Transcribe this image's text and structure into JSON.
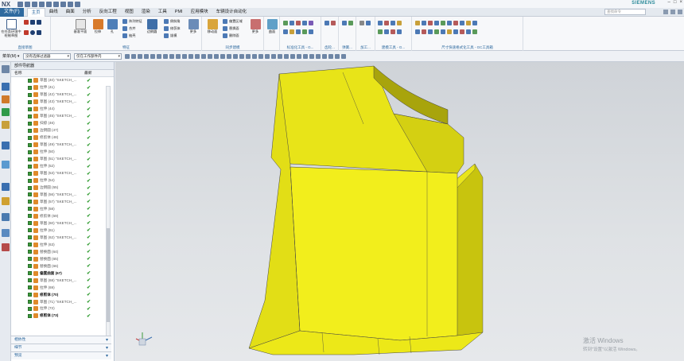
{
  "titlebar": {
    "app_logo": "NX",
    "window_title": "",
    "brand": "SIEMENS"
  },
  "tabs": {
    "file": "文件(F)",
    "items": [
      "主页",
      "曲线",
      "曲面",
      "分析",
      "视图",
      "渲染",
      "工具",
      "PMI",
      "应用模块",
      "车辆设计自动化"
    ],
    "extra": "反向工程",
    "active_index": 0,
    "search_placeholder": "查找命令"
  },
  "ribbon": {
    "sketch_button": "在任务环境中绘制草图",
    "group_direct_sketch": "直接草图",
    "group_feature": "特征",
    "group_sync": "同步建模",
    "group_standard": "标准化工具 - G...",
    "group_gear": "齿轮...",
    "group_spring": "弹簧...",
    "group_machining": "加工...",
    "group_build": "建模工具 - G...",
    "group_dimension": "尺寸快速格式化工具 - GC工具箱",
    "datum_plane": "基准平面",
    "extrude": "拉伸",
    "hole": "孔",
    "array_feature": "阵列特征",
    "unite": "合并",
    "shell": "抽壳",
    "edge_blend": "边倒圆",
    "chamfer": "倒斜角",
    "trim_body": "修剪体",
    "draft": "拔模",
    "more": "更多",
    "move_face": "移动面",
    "offset_region": "偏置区域",
    "replace_face": "替换面",
    "delete_face": "删除面",
    "surface": "曲面"
  },
  "selection_bar": {
    "menu": "菜单(M) ▾",
    "filter": "没有选择过滤器",
    "scope": "仅在工作部件内"
  },
  "navigator": {
    "title": "部件导航器",
    "col_name": "名称",
    "col_latest": "最新",
    "rows": [
      {
        "label": "草图 (40) \"SKETCH_..."
      },
      {
        "label": "拉伸 (41)"
      },
      {
        "label": "草图 (42) \"SKETCH_..."
      },
      {
        "label": "草图 (43) \"SKETCH_..."
      },
      {
        "label": "拉伸 (44)"
      },
      {
        "label": "草图 (45) \"SKETCH_..."
      },
      {
        "label": "扫掠 (46)"
      },
      {
        "label": "边倒圆 (47)"
      },
      {
        "label": "修剪体 (48)"
      },
      {
        "label": "草图 (49) \"SKETCH_..."
      },
      {
        "label": "拉伸 (50)"
      },
      {
        "label": "草图 (51) \"SKETCH_..."
      },
      {
        "label": "拉伸 (52)"
      },
      {
        "label": "草图 (53) \"SKETCH_..."
      },
      {
        "label": "拉伸 (54)"
      },
      {
        "label": "边倒圆 (55)"
      },
      {
        "label": "草图 (56) \"SKETCH_..."
      },
      {
        "label": "草图 (57) \"SKETCH_..."
      },
      {
        "label": "拉伸 (58)"
      },
      {
        "label": "修剪体 (59)"
      },
      {
        "label": "草图 (60) \"SKETCH_..."
      },
      {
        "label": "拉伸 (61)"
      },
      {
        "label": "草图 (62) \"SKETCH_..."
      },
      {
        "label": "拉伸 (63)"
      },
      {
        "label": "替换面 (64)"
      },
      {
        "label": "替换面 (65)"
      },
      {
        "label": "替换面 (66)"
      },
      {
        "label": "偏置曲面 (67)",
        "bold": true
      },
      {
        "label": "草图 (68) \"SKETCH_..."
      },
      {
        "label": "拉伸 (69)"
      },
      {
        "label": "修剪体 (70)",
        "bold": true
      },
      {
        "label": "草图 (71) \"SKETCH_..."
      },
      {
        "label": "拉伸 (72)"
      },
      {
        "label": "修剪体 (73)",
        "bold": true
      }
    ],
    "panels": [
      "相依性",
      "细节",
      "预览"
    ]
  },
  "viewport": {
    "watermark_title": "激活 Windows",
    "watermark_sub": "转到\"设置\"以激活 Windows。"
  },
  "colors": {
    "model": "#f2ee1c",
    "file_tab": "#2f6a9f",
    "check": "#2d9a2d"
  }
}
